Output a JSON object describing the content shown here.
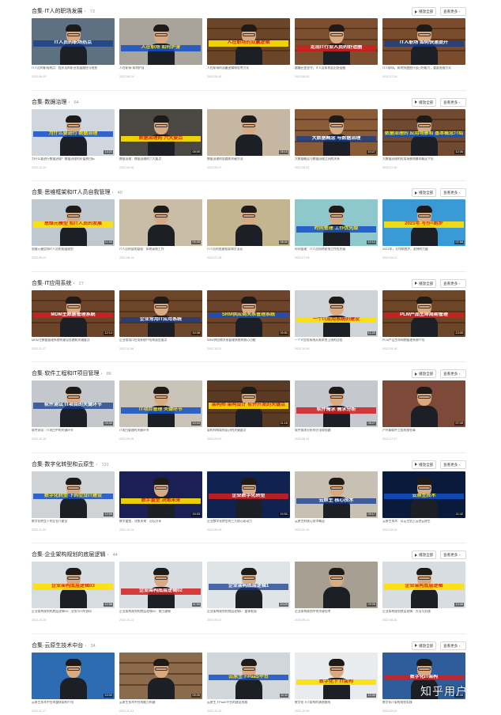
{
  "buttons": {
    "play_all": "播放全部",
    "view_more": "查看更多 ›"
  },
  "watermark": "知乎用户",
  "sections": [
    {
      "title": "合集·IT人的职场发展",
      "count": "73",
      "cards": [
        {
          "caption": "IT人员的职场热点",
          "duration": "",
          "title": "IT人员的职场热点：程序员的职业发展路径与规划",
          "date": "2022-09-15"
        },
        {
          "caption": "人在职场 如何护身",
          "duration": "",
          "title": "人在职场·如何护身",
          "date": "2022-08-29"
        },
        {
          "caption": "人在职场的双赢逻辑",
          "duration": "",
          "title": "人在职场的双赢逻辑和思考方式",
          "date": "2022-08-16"
        },
        {
          "caption": "走出IT行业人员的舒适圈",
          "duration": "",
          "title": "跳槽还是坚守，IT人员如何走出舒适圈",
          "date": "2022-08-03"
        },
        {
          "caption": "IT人职场 如何快速提升",
          "duration": "",
          "title": "IT人职场，如何快速提升自己的能力，重要思维方式",
          "date": "2022-07-24"
        }
      ]
    },
    {
      "title": "合集·数据治理",
      "count": "64",
      "cards": [
        {
          "caption": "为什么要进行 数据治理",
          "duration": "13:21",
          "title": "为什么要进行数据治理？数据治理的价值和目标",
          "date": "2022-10-19"
        },
        {
          "caption": "数据治理的 六大要点",
          "duration": "08:05",
          "title": "数据治理：数据治理的六大要点",
          "date": "2022-09-20"
        },
        {
          "caption": "",
          "duration": "08:15",
          "title": "数据治理的思路和关键方法",
          "date": "2022-09-07"
        },
        {
          "caption": "大数据概念 与数据治理",
          "duration": "10:27",
          "title": "大数据概念与数据治理之间的关系",
          "date": "2022-08-22"
        },
        {
          "caption": "数据治理的 应用场景和 基本概念介绍",
          "duration": "12:36",
          "title": "大数据治理的应用场景和基本概念介绍",
          "date": "2022-07-30"
        }
      ]
    },
    {
      "title": "合集·思维框架和IT人员自我管理",
      "count": "40",
      "cards": [
        {
          "caption": "思维元模型 和IT人员的发展",
          "duration": "11:03",
          "title": "思维元模型和IT人员的发展规划",
          "date": "2022-09-02"
        },
        {
          "caption": "",
          "duration": "09:45",
          "title": "IT人员的自我管理：如何高效工作",
          "date": "2022-08-16"
        },
        {
          "caption": "",
          "duration": "08:32",
          "title": "IT人员的思维框架和方法论",
          "date": "2022-07-28"
        },
        {
          "caption": "时间管理 工作优先级",
          "duration": "10:12",
          "title": "时间管理：IT人员如何安排工作优先级",
          "date": "2022-07-09"
        },
        {
          "caption": "2021年 写作+跑步",
          "duration": "07:58",
          "title": "2021年，写作和跑步，坚持的力量",
          "date": "2022-06-21"
        }
      ]
    },
    {
      "title": "合集·IT应用系统",
      "count": "27",
      "cards": [
        {
          "caption": "MDM主数据管理系统",
          "duration": "12:14",
          "title": "MDM主数据管理系统的建设思路和关键要点",
          "date": "2022-11-27"
        },
        {
          "caption": "企业常用IT应用系统",
          "duration": "10:38",
          "title": "企业常用IT应用系统介绍和选型要点",
          "date": "2022-11-08"
        },
        {
          "caption": "SRM供应商关系管理系统",
          "duration": "09:51",
          "title": "SRM供应商关系管理系统的核心功能",
          "date": "2022-10-21"
        },
        {
          "caption": "一个IT应用系统的建设",
          "duration": "11:20",
          "title": "一个IT应用系统从需求到上线的过程",
          "date": "2022-10-04"
        },
        {
          "caption": "PLM产品生命周期管理",
          "duration": "13:05",
          "title": "PLM产品生命周期管理系统介绍",
          "date": "2022-09-16"
        }
      ]
    },
    {
      "title": "合集·软件工程和IT项目管理",
      "count": "86",
      "cards": [
        {
          "caption": "软件测试 IT项目的关键环节",
          "duration": "09:30",
          "title": "软件测试：IT项目中的关键环节",
          "date": "2022-10-18"
        },
        {
          "caption": "IT项目管理 关键环节",
          "duration": "10:44",
          "title": "IT项目管理的关键环节",
          "date": "2022-09-25"
        },
        {
          "caption": "架构师 架构设计 软件开发的关键点",
          "duration": "11:16",
          "title": "架构师和架构设计的关键要点",
          "date": "2022-09-02"
        },
        {
          "caption": "软件需求 需求分析",
          "duration": "08:27",
          "title": "软件需求分析的方法和思路",
          "date": "2022-08-13"
        },
        {
          "caption": "",
          "duration": "07:49",
          "title": "户外聊软件工程的那些事",
          "date": "2022-07-27"
        }
      ]
    },
    {
      "title": "合集·数字化转型和云原生",
      "count": "131",
      "cards": [
        {
          "caption": "数字化转型 下的企业IT建设",
          "duration": "12:09",
          "title": "数字化转型下的企业IT建设",
          "date": "2022-11-02"
        },
        {
          "caption": "数字重塑 决策未来",
          "duration": "15:33",
          "title": "数字重塑，决策未来：论坛分享",
          "date": "2022-10-15"
        },
        {
          "caption": "企业数字化转型",
          "duration": "10:51",
          "title": "企业数字化转型的三大核心驱动力",
          "date": "2022-09-28"
        },
        {
          "caption": "云原生 核心技术",
          "duration": "09:17",
          "title": "云原生的核心技术概念",
          "date": "2022-09-10"
        },
        {
          "caption": "云原生技术",
          "duration": "11:42",
          "title": "云原生技术：从云主机上云到云原生",
          "date": "2022-08-24"
        }
      ]
    },
    {
      "title": "合集·企业架构规划的底层逻辑",
      "count": "44",
      "cards": [
        {
          "caption": "企业架构底层逻辑03",
          "duration": "12:58",
          "title": "企业架构规划的底层逻辑03：业务与IT的协同",
          "date": "2022-10-25"
        },
        {
          "caption": "企业架构底层逻辑02",
          "duration": "11:34",
          "title": "企业架构规划的底层逻辑02：能力建模",
          "date": "2022-10-11"
        },
        {
          "caption": "企业架构底层逻辑1",
          "duration": "10:20",
          "title": "企业架构规划的底层逻辑1：整体框架",
          "date": "2022-09-27"
        },
        {
          "caption": "",
          "duration": "09:05",
          "title": "企业架构规划中的关键思考",
          "date": "2022-09-13"
        },
        {
          "caption": "企业架构底层逻辑",
          "duration": "13:46",
          "title": "企业架构规划底层逻辑：方法与实践",
          "date": "2022-08-30"
        }
      ]
    },
    {
      "title": "合集·云原生技术中台",
      "count": "34",
      "cards": [
        {
          "caption": "",
          "duration": "10:02",
          "title": "云原生技术中台的整体架构介绍",
          "date": "2022-11-17"
        },
        {
          "caption": "",
          "duration": "09:26",
          "title": "云原生技术中台的能力构建",
          "date": "2022-11-03"
        },
        {
          "caption": "云原生下PaaS平台",
          "duration": "11:11",
          "title": "云原生下PaaS平台的建设思路",
          "date": "2022-10-20"
        },
        {
          "caption": "数字化下 IT架构",
          "duration": "12:30",
          "title": "数字化下IT架构的演进路线",
          "date": "2022-10-06"
        },
        {
          "caption": "数字化IT架构",
          "duration": "10:48",
          "title": "数字化IT架构规划实践",
          "date": "2022-09-22"
        }
      ]
    }
  ],
  "thumb_styles": [
    [
      "#6a7a88",
      "#2b4a8a",
      "#e8f4ff"
    ],
    [
      "#b8b1a6",
      "#ffffff",
      "#1b6dd9"
    ],
    [
      "#7b4a2f",
      "#ffffff",
      "#1b4fbf"
    ],
    [
      "#8a5a38",
      "#ffe100",
      "#d31a1a"
    ],
    [
      "#7e5030",
      "#ffe100",
      "#d31a1a"
    ]
  ]
}
